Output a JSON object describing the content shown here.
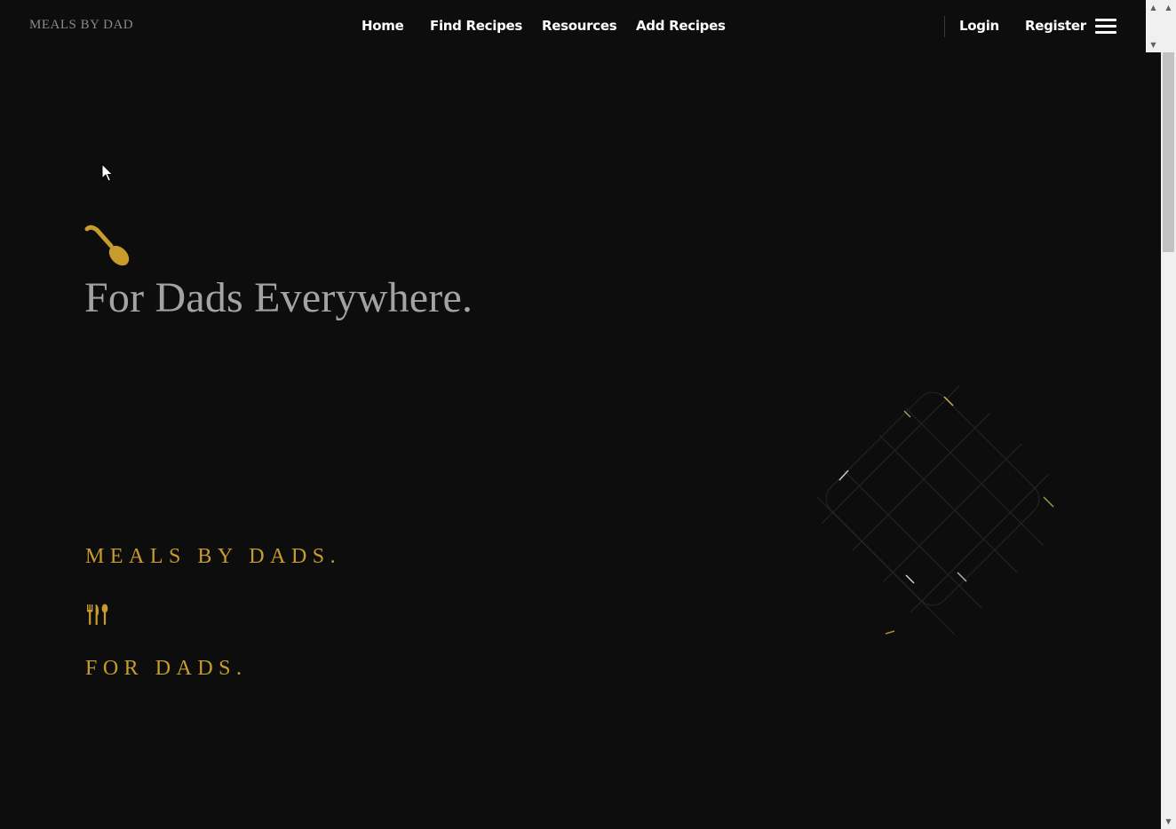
{
  "header": {
    "brand": "MEALS BY DAD",
    "nav": {
      "home": "Home",
      "find_recipes": "Find Recipes",
      "resources": "Resources",
      "add_recipes": "Add Recipes",
      "login": "Login",
      "register": "Register"
    },
    "menu_icon": "hamburger-menu-icon"
  },
  "hero": {
    "icon": "spoon-icon",
    "title": "For Dads Everywhere.",
    "tagline_primary": "MEALS BY DADS.",
    "divider_icon": "utensils-icon",
    "tagline_secondary": "FOR DADS."
  },
  "colors": {
    "background": "#0d0d0d",
    "accent_gold": "#c79c2c",
    "title_gray": "#a3a3a3",
    "brand_gray": "#8a8a8a",
    "nav_text": "#ffffff"
  }
}
